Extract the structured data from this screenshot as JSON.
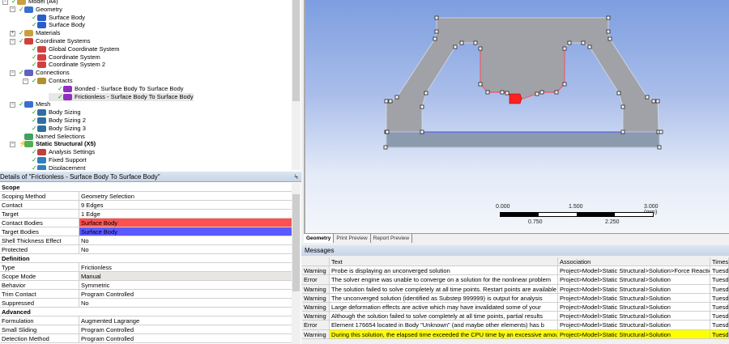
{
  "tree": {
    "items": [
      {
        "label": "Model (A4)",
        "level": 0,
        "icon": "model-icon",
        "expander": "minus"
      },
      {
        "label": "Geometry",
        "level": 1,
        "icon": "geometry-icon",
        "expander": "minus"
      },
      {
        "label": "Surface Body",
        "level": 2,
        "icon": "surface-body-icon"
      },
      {
        "label": "Surface Body",
        "level": 2,
        "icon": "surface-body-icon"
      },
      {
        "label": "Materials",
        "level": 1,
        "icon": "materials-icon",
        "expander": "plus"
      },
      {
        "label": "Coordinate Systems",
        "level": 1,
        "icon": "coordinate-system-icon",
        "expander": "minus"
      },
      {
        "label": "Global Coordinate System",
        "level": 2,
        "icon": "coordinate-system-icon"
      },
      {
        "label": "Coordinate System",
        "level": 2,
        "icon": "coordinate-system-icon"
      },
      {
        "label": "Coordinate System 2",
        "level": 2,
        "icon": "coordinate-system-icon"
      },
      {
        "label": "Connections",
        "level": 1,
        "icon": "connections-icon",
        "expander": "minus"
      },
      {
        "label": "Contacts",
        "level": 2,
        "icon": "contacts-icon",
        "expander": "minus"
      },
      {
        "label": "Bonded - Surface Body To Surface Body",
        "level": 3,
        "icon": "contact-region-icon"
      },
      {
        "label": "Frictionless - Surface Body To Surface Body",
        "level": 3,
        "icon": "contact-region-icon",
        "selected": true
      },
      {
        "label": "Mesh",
        "level": 1,
        "icon": "mesh-icon",
        "expander": "minus"
      },
      {
        "label": "Body Sizing",
        "level": 2,
        "icon": "body-sizing-icon"
      },
      {
        "label": "Body Sizing 2",
        "level": 2,
        "icon": "body-sizing-icon"
      },
      {
        "label": "Body Sizing 3",
        "level": 2,
        "icon": "body-sizing-icon"
      },
      {
        "label": "Named Selections",
        "level": 1,
        "icon": "named-selections-icon",
        "nocheck": true
      },
      {
        "label": "Static Structural (X5)",
        "level": 1,
        "icon": "static-structural-icon",
        "expander": "minus",
        "bold": true,
        "lightning": true
      },
      {
        "label": "Analysis Settings",
        "level": 2,
        "icon": "analysis-settings-icon"
      },
      {
        "label": "Fixed Support",
        "level": 2,
        "icon": "fixed-support-icon"
      },
      {
        "label": "Displacement",
        "level": 2,
        "icon": "displacement-icon"
      }
    ]
  },
  "details": {
    "title": "Details of \"Frictionless - Surface Body To Surface Body\"",
    "pin": "⍀",
    "rows": [
      {
        "section": "Scope"
      },
      {
        "key": "Scoping Method",
        "value": "Geometry Selection"
      },
      {
        "key": "Contact",
        "value": "9 Edges"
      },
      {
        "key": "Target",
        "value": "1 Edge"
      },
      {
        "key": "Contact Bodies",
        "value": "Surface Body",
        "color": "#ff5050"
      },
      {
        "key": "Target Bodies",
        "value": "Surface Body",
        "color": "#5a5aff"
      },
      {
        "key": "Shell Thickness Effect",
        "value": "No"
      },
      {
        "key": "Protected",
        "value": "No"
      },
      {
        "section": "Definition"
      },
      {
        "key": "Type",
        "value": "Frictionless"
      },
      {
        "key": "Scope Mode",
        "value": "Manual",
        "color": "#e8e6e2"
      },
      {
        "key": "Behavior",
        "value": "Symmetric"
      },
      {
        "key": "Trim Contact",
        "value": "Program Controlled"
      },
      {
        "key": "Suppressed",
        "value": "No"
      },
      {
        "section": "Advanced"
      },
      {
        "key": "Formulation",
        "value": "Augmented Lagrange"
      },
      {
        "key": "Small Sliding",
        "value": "Program Controlled"
      },
      {
        "key": "Detection Method",
        "value": "Program Controlled"
      }
    ]
  },
  "viewport": {
    "scale": {
      "labels_top": [
        "0.000",
        "1.500",
        "3.000 (mm)"
      ],
      "labels_bottom": [
        "0.750",
        "2.250"
      ]
    },
    "tabs": [
      "Geometry",
      "Print Preview",
      "Report Preview"
    ]
  },
  "messages": {
    "title": "Messages",
    "columns": [
      "",
      "Text",
      "Association",
      "Timestamp"
    ],
    "rows": [
      {
        "type": "Warning",
        "text": "Probe is displaying an unconverged solution",
        "assoc": "Project>Model>Static Structural>Solution>Force Reaction",
        "time": "Tuesday"
      },
      {
        "type": "Error",
        "text": "The solver engine was unable to converge on a solution for the nonlinear problem",
        "assoc": "Project>Model>Static Structural>Solution",
        "time": "Tuesday"
      },
      {
        "type": "Warning",
        "text": "The solution failed to solve completely at all time points. Restart points are available",
        "assoc": "Project>Model>Static Structural>Solution",
        "time": "Tuesday"
      },
      {
        "type": "Warning",
        "text": "The unconverged solution (identified as Substep 999999) is output for analysis",
        "assoc": "Project>Model>Static Structural>Solution",
        "time": "Tuesday"
      },
      {
        "type": "Warning",
        "text": "Large deformation effects are active which may have invalidated some of your",
        "assoc": "Project>Model>Static Structural>Solution",
        "time": "Tuesday"
      },
      {
        "type": "Warning",
        "text": "Although the solution failed to solve completely at all time points, partial results",
        "assoc": "Project>Model>Static Structural>Solution",
        "time": "Tuesday"
      },
      {
        "type": "Error",
        "text": "Element 176654 located in Body \"Unknown\" (and maybe other elements) has b",
        "assoc": "Project>Model>Static Structural>Solution",
        "time": "Tuesday"
      },
      {
        "type": "Warning",
        "text": "During this solution, the elapsed time exceeded the CPU time by an excessive amount",
        "assoc": "Project>Model>Static Structural>Solution",
        "time": "Tuesday",
        "highlight": true
      }
    ]
  }
}
